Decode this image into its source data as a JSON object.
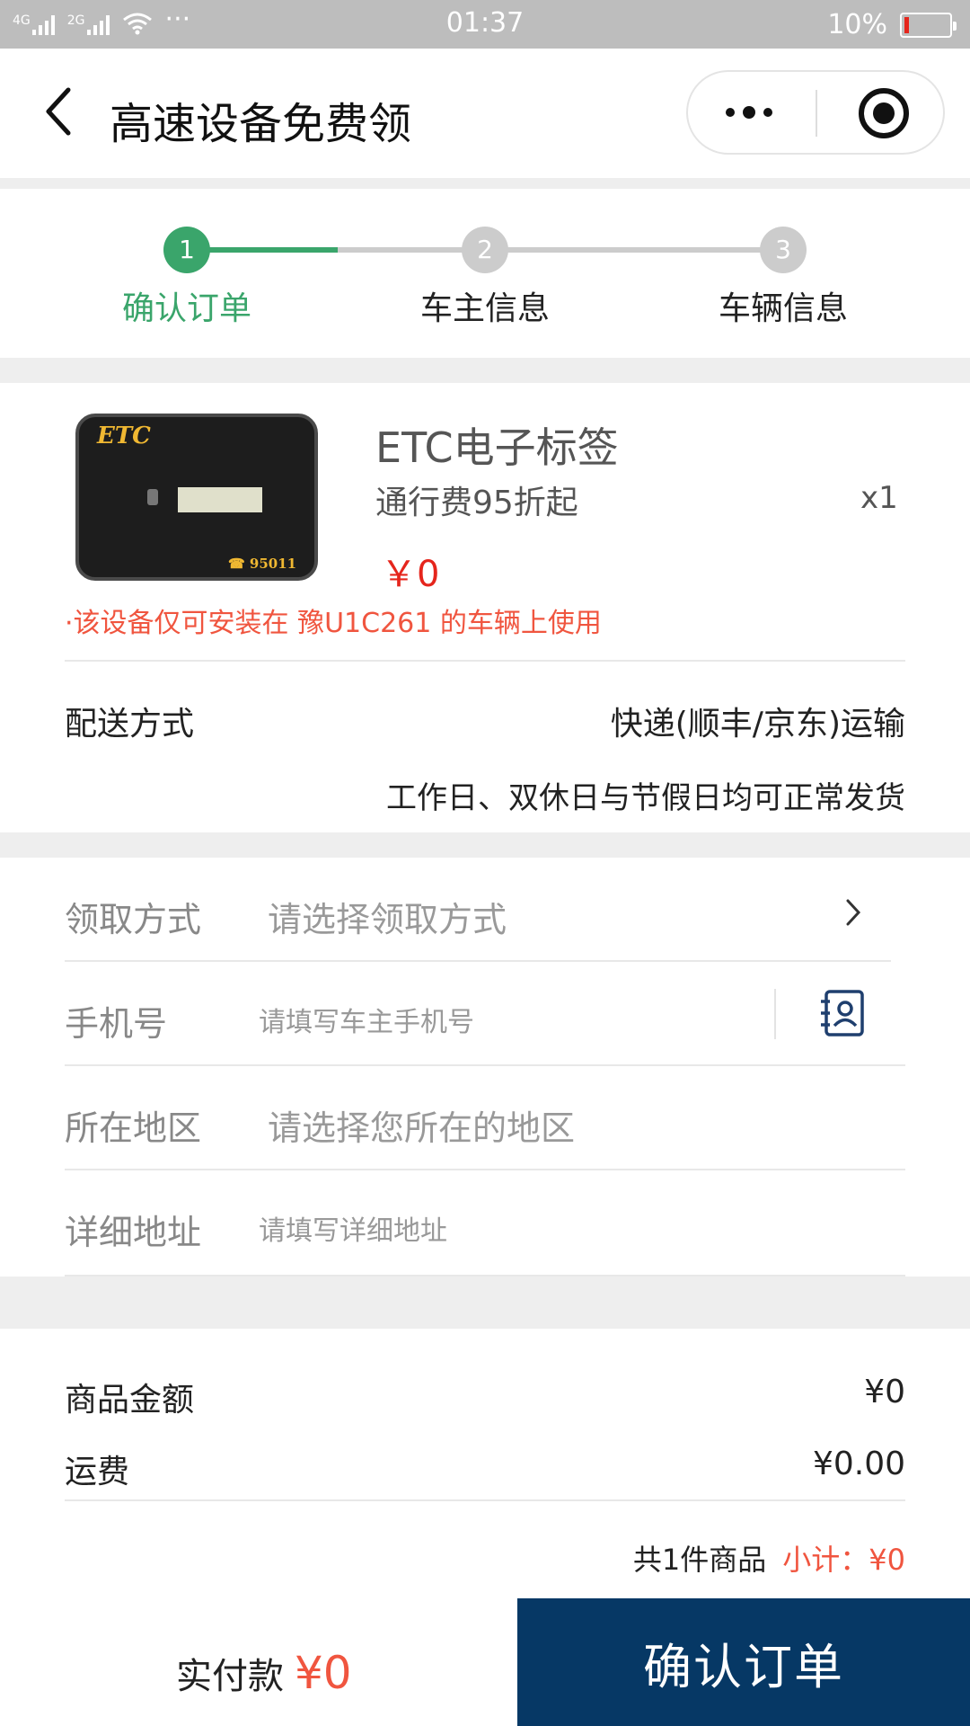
{
  "status_bar": {
    "network_1": "4G",
    "network_2": "2G",
    "dots": "···",
    "time": "01:37",
    "battery": "10%",
    "battery_level": 0.1,
    "battery_color": "#e5251c"
  },
  "nav": {
    "title": "高速设备免费领"
  },
  "steps": [
    {
      "num": "1",
      "label": "确认订单",
      "active": true
    },
    {
      "num": "2",
      "label": "车主信息",
      "active": false
    },
    {
      "num": "3",
      "label": "车辆信息",
      "active": false
    }
  ],
  "colors": {
    "accent_green": "#3aa56b",
    "inactive_gray": "#cccccc",
    "price_red": "#e5251c",
    "note_red": "#f0553f",
    "button_navy": "#063865"
  },
  "product": {
    "device_logo": "ETC",
    "device_phone": "☎ 95011",
    "name": "ETC电子标签",
    "subtitle": "通行费95折起",
    "quantity": "x1",
    "price": "￥0",
    "note": "·该设备仅可安装在 豫U1C261 的车辆上使用"
  },
  "shipping": {
    "label": "配送方式",
    "value": "快递(顺丰/京东)运输",
    "note": "工作日、双休日与节假日均可正常发货"
  },
  "form": {
    "pickup": {
      "label": "领取方式",
      "placeholder": "请选择领取方式"
    },
    "phone": {
      "label": "手机号",
      "placeholder": "请填写车主手机号"
    },
    "region": {
      "label": "所在地区",
      "placeholder": "请选择您所在的地区"
    },
    "address": {
      "label": "详细地址",
      "placeholder": "请填写详细地址"
    }
  },
  "summary": {
    "goods_label": "商品金额",
    "goods_value": "¥0",
    "shipping_label": "运费",
    "shipping_value": "¥0.00",
    "count_text": "共1件商品",
    "subtotal_text": "小计：¥0"
  },
  "footer": {
    "pay_label": "实付款",
    "pay_amount": "¥0",
    "confirm_label": "确认订单"
  }
}
